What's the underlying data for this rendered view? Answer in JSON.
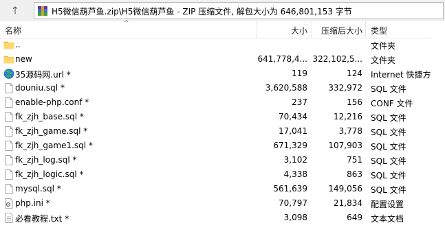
{
  "path": "H5微信葫芦鱼.zip\\H5微信葫芦鱼 - ZIP 压缩文件, 解包大小为 646,801,153 字节",
  "columns": {
    "name": "名称",
    "size": "大小",
    "packed": "压缩后大小",
    "type": "类型"
  },
  "files": [
    {
      "name": "..",
      "size": "",
      "packed": "",
      "type": "文件夹",
      "icon": "folder-icon"
    },
    {
      "name": "new",
      "size": "641,778,4...",
      "packed": "322,102,5...",
      "type": "文件夹",
      "icon": "folder-icon"
    },
    {
      "name": "35源码网.url *",
      "size": "119",
      "packed": "124",
      "type": "Internet 快捷方式",
      "icon": "globe-icon"
    },
    {
      "name": "douniu.sql *",
      "size": "3,620,588",
      "packed": "332,972",
      "type": "SQL 文件",
      "icon": "file-icon"
    },
    {
      "name": "enable-php.conf *",
      "size": "237",
      "packed": "156",
      "type": "CONF 文件",
      "icon": "file-icon"
    },
    {
      "name": "fk_zjh_base.sql *",
      "size": "70,434",
      "packed": "12,216",
      "type": "SQL 文件",
      "icon": "file-icon"
    },
    {
      "name": "fk_zjh_game.sql *",
      "size": "17,041",
      "packed": "3,778",
      "type": "SQL 文件",
      "icon": "file-icon"
    },
    {
      "name": "fk_zjh_game1.sql *",
      "size": "671,329",
      "packed": "107,903",
      "type": "SQL 文件",
      "icon": "file-icon"
    },
    {
      "name": "fk_zjh_log.sql *",
      "size": "3,102",
      "packed": "751",
      "type": "SQL 文件",
      "icon": "file-icon"
    },
    {
      "name": "fk_zjh_logic.sql *",
      "size": "4,338",
      "packed": "863",
      "type": "SQL 文件",
      "icon": "file-icon"
    },
    {
      "name": "mysql.sql *",
      "size": "561,639",
      "packed": "149,056",
      "type": "SQL 文件",
      "icon": "file-icon"
    },
    {
      "name": "php.ini *",
      "size": "70,797",
      "packed": "21,834",
      "type": "配置设置",
      "icon": "settings-file-icon"
    },
    {
      "name": "必看教程.txt *",
      "size": "3,098",
      "packed": "649",
      "type": "文本文档",
      "icon": "text-file-icon"
    }
  ]
}
